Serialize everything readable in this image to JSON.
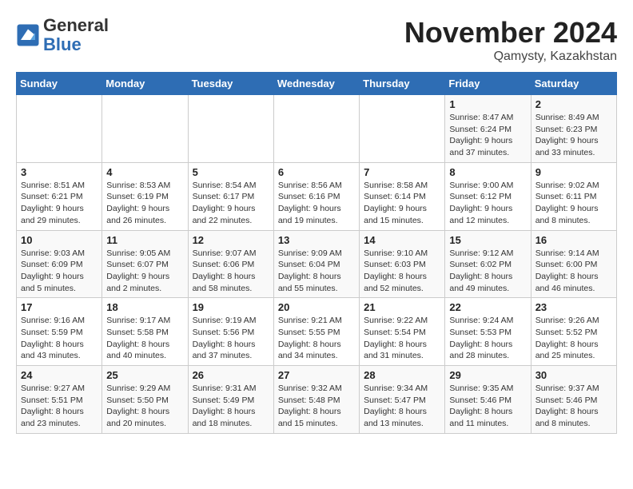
{
  "header": {
    "logo_general": "General",
    "logo_blue": "Blue",
    "month_year": "November 2024",
    "location": "Qamysty, Kazakhstan"
  },
  "weekdays": [
    "Sunday",
    "Monday",
    "Tuesday",
    "Wednesday",
    "Thursday",
    "Friday",
    "Saturday"
  ],
  "weeks": [
    [
      {
        "day": "",
        "info": ""
      },
      {
        "day": "",
        "info": ""
      },
      {
        "day": "",
        "info": ""
      },
      {
        "day": "",
        "info": ""
      },
      {
        "day": "",
        "info": ""
      },
      {
        "day": "1",
        "info": "Sunrise: 8:47 AM\nSunset: 6:24 PM\nDaylight: 9 hours and 37 minutes."
      },
      {
        "day": "2",
        "info": "Sunrise: 8:49 AM\nSunset: 6:23 PM\nDaylight: 9 hours and 33 minutes."
      }
    ],
    [
      {
        "day": "3",
        "info": "Sunrise: 8:51 AM\nSunset: 6:21 PM\nDaylight: 9 hours and 29 minutes."
      },
      {
        "day": "4",
        "info": "Sunrise: 8:53 AM\nSunset: 6:19 PM\nDaylight: 9 hours and 26 minutes."
      },
      {
        "day": "5",
        "info": "Sunrise: 8:54 AM\nSunset: 6:17 PM\nDaylight: 9 hours and 22 minutes."
      },
      {
        "day": "6",
        "info": "Sunrise: 8:56 AM\nSunset: 6:16 PM\nDaylight: 9 hours and 19 minutes."
      },
      {
        "day": "7",
        "info": "Sunrise: 8:58 AM\nSunset: 6:14 PM\nDaylight: 9 hours and 15 minutes."
      },
      {
        "day": "8",
        "info": "Sunrise: 9:00 AM\nSunset: 6:12 PM\nDaylight: 9 hours and 12 minutes."
      },
      {
        "day": "9",
        "info": "Sunrise: 9:02 AM\nSunset: 6:11 PM\nDaylight: 9 hours and 8 minutes."
      }
    ],
    [
      {
        "day": "10",
        "info": "Sunrise: 9:03 AM\nSunset: 6:09 PM\nDaylight: 9 hours and 5 minutes."
      },
      {
        "day": "11",
        "info": "Sunrise: 9:05 AM\nSunset: 6:07 PM\nDaylight: 9 hours and 2 minutes."
      },
      {
        "day": "12",
        "info": "Sunrise: 9:07 AM\nSunset: 6:06 PM\nDaylight: 8 hours and 58 minutes."
      },
      {
        "day": "13",
        "info": "Sunrise: 9:09 AM\nSunset: 6:04 PM\nDaylight: 8 hours and 55 minutes."
      },
      {
        "day": "14",
        "info": "Sunrise: 9:10 AM\nSunset: 6:03 PM\nDaylight: 8 hours and 52 minutes."
      },
      {
        "day": "15",
        "info": "Sunrise: 9:12 AM\nSunset: 6:02 PM\nDaylight: 8 hours and 49 minutes."
      },
      {
        "day": "16",
        "info": "Sunrise: 9:14 AM\nSunset: 6:00 PM\nDaylight: 8 hours and 46 minutes."
      }
    ],
    [
      {
        "day": "17",
        "info": "Sunrise: 9:16 AM\nSunset: 5:59 PM\nDaylight: 8 hours and 43 minutes."
      },
      {
        "day": "18",
        "info": "Sunrise: 9:17 AM\nSunset: 5:58 PM\nDaylight: 8 hours and 40 minutes."
      },
      {
        "day": "19",
        "info": "Sunrise: 9:19 AM\nSunset: 5:56 PM\nDaylight: 8 hours and 37 minutes."
      },
      {
        "day": "20",
        "info": "Sunrise: 9:21 AM\nSunset: 5:55 PM\nDaylight: 8 hours and 34 minutes."
      },
      {
        "day": "21",
        "info": "Sunrise: 9:22 AM\nSunset: 5:54 PM\nDaylight: 8 hours and 31 minutes."
      },
      {
        "day": "22",
        "info": "Sunrise: 9:24 AM\nSunset: 5:53 PM\nDaylight: 8 hours and 28 minutes."
      },
      {
        "day": "23",
        "info": "Sunrise: 9:26 AM\nSunset: 5:52 PM\nDaylight: 8 hours and 25 minutes."
      }
    ],
    [
      {
        "day": "24",
        "info": "Sunrise: 9:27 AM\nSunset: 5:51 PM\nDaylight: 8 hours and 23 minutes."
      },
      {
        "day": "25",
        "info": "Sunrise: 9:29 AM\nSunset: 5:50 PM\nDaylight: 8 hours and 20 minutes."
      },
      {
        "day": "26",
        "info": "Sunrise: 9:31 AM\nSunset: 5:49 PM\nDaylight: 8 hours and 18 minutes."
      },
      {
        "day": "27",
        "info": "Sunrise: 9:32 AM\nSunset: 5:48 PM\nDaylight: 8 hours and 15 minutes."
      },
      {
        "day": "28",
        "info": "Sunrise: 9:34 AM\nSunset: 5:47 PM\nDaylight: 8 hours and 13 minutes."
      },
      {
        "day": "29",
        "info": "Sunrise: 9:35 AM\nSunset: 5:46 PM\nDaylight: 8 hours and 11 minutes."
      },
      {
        "day": "30",
        "info": "Sunrise: 9:37 AM\nSunset: 5:46 PM\nDaylight: 8 hours and 8 minutes."
      }
    ]
  ]
}
